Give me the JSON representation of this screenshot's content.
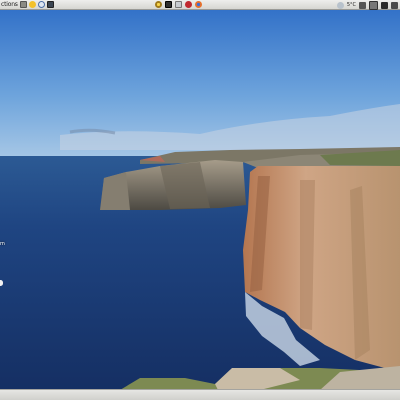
{
  "top_panel": {
    "menu_label": "ctions",
    "launchers": [
      "file-manager-icon",
      "favorites-star-icon",
      "search-icon",
      "monitor-icon"
    ],
    "center_apps": [
      "chromium-icon",
      "terminal-icon",
      "network-icon",
      "redhat-icon",
      "firefox-icon"
    ],
    "tray": {
      "temperature": "5°C",
      "icons": [
        "volume-icon",
        "keyboard-icon",
        "power-icon",
        "network-status-icon"
      ]
    }
  },
  "desktop": {
    "icon_label_fragment": "m"
  },
  "colors": {
    "sky_top": "#2e6fc4",
    "sky_bottom": "#9cc4e4",
    "sea": "#1d3f7a",
    "cliff": "#b88a63"
  }
}
